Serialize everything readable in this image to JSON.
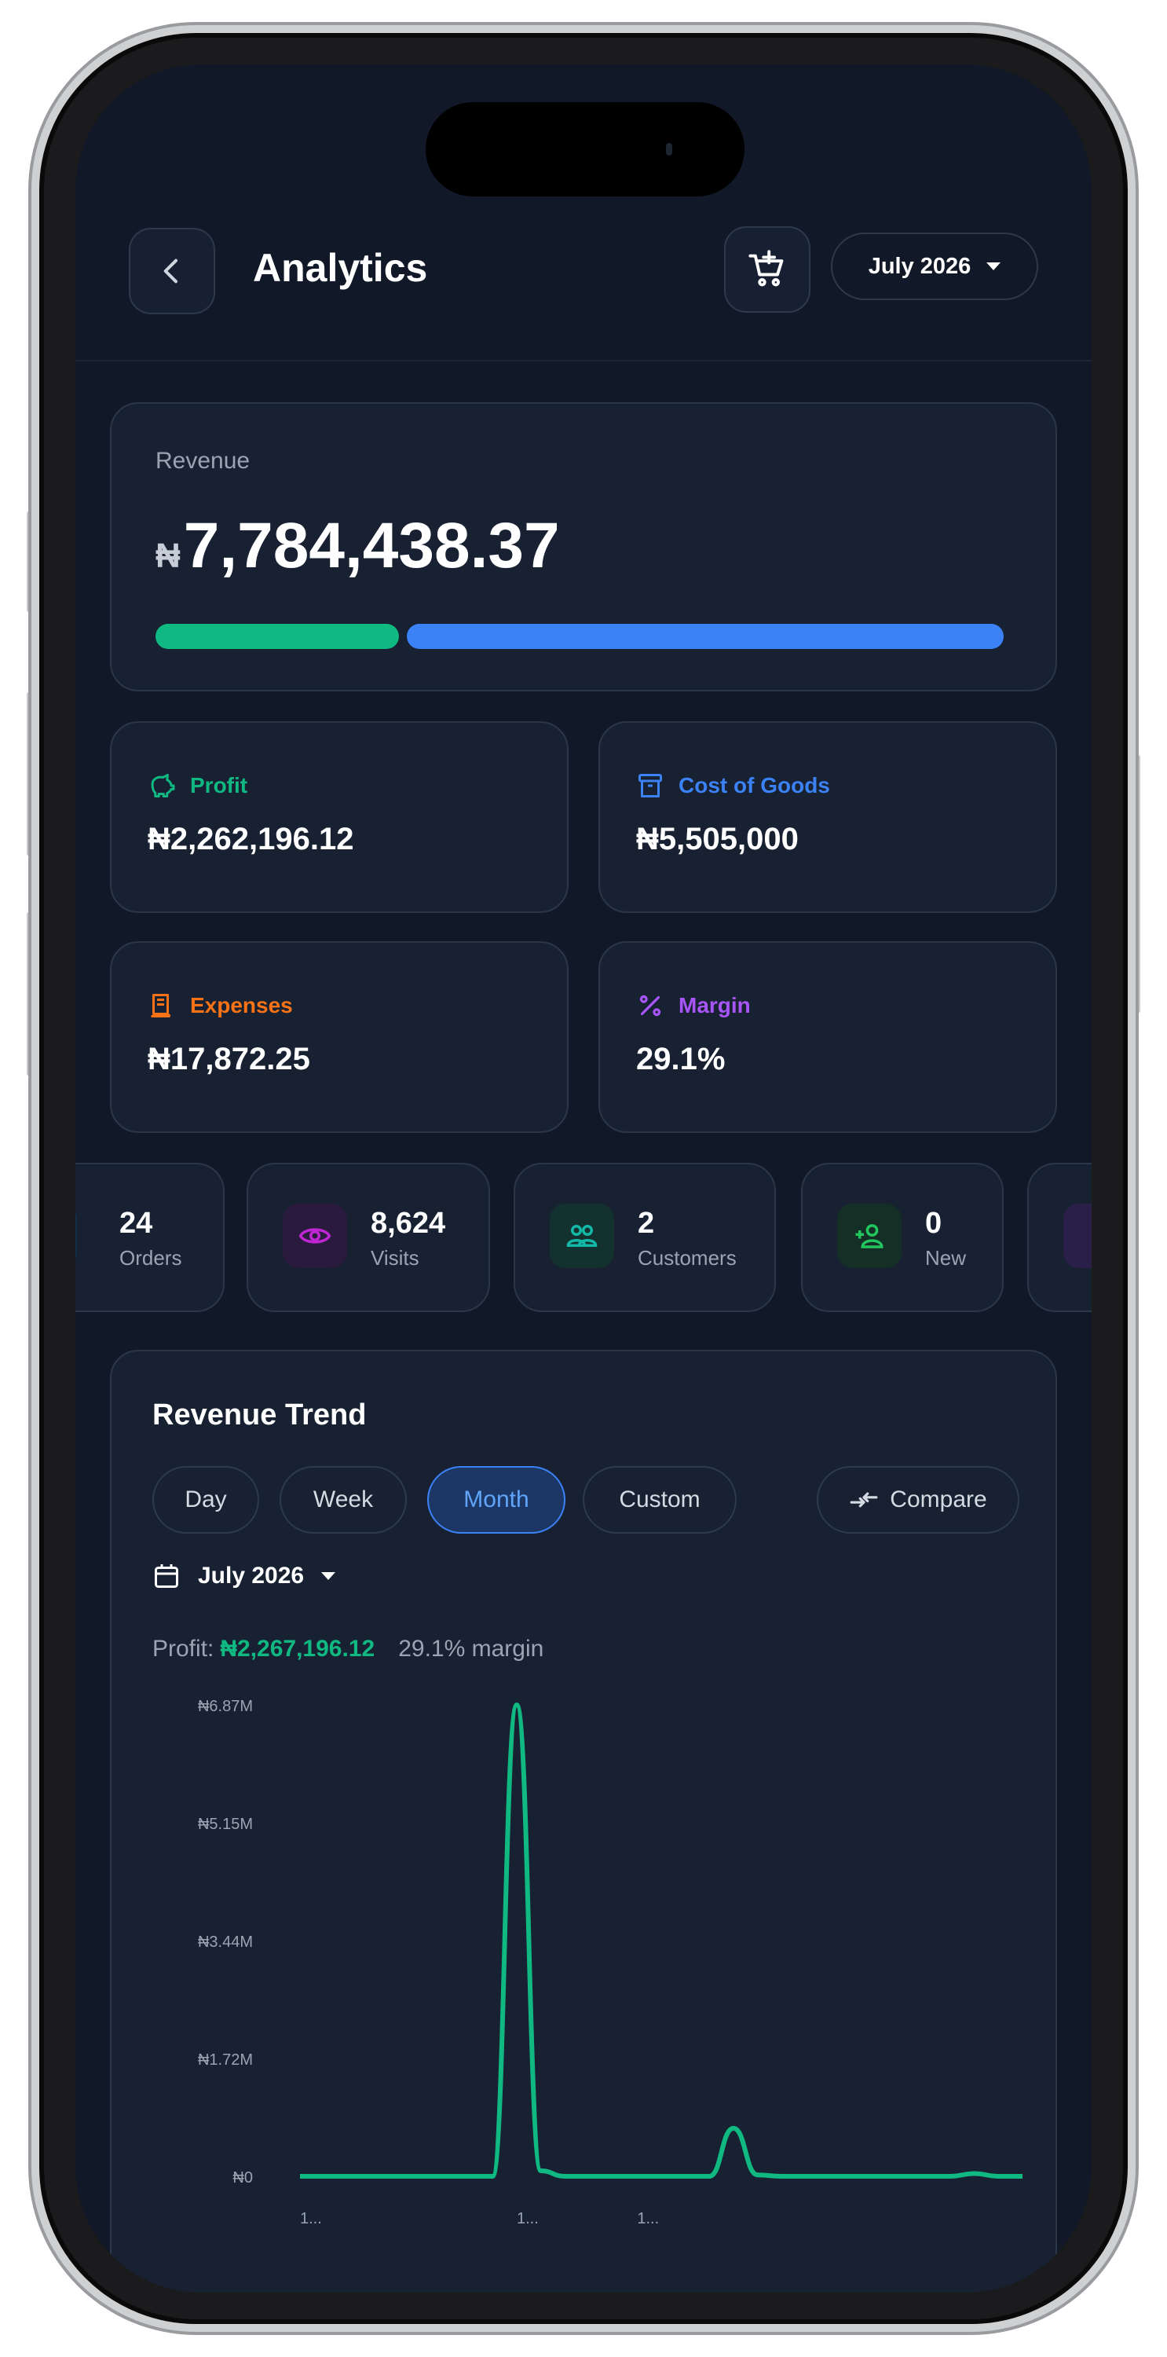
{
  "header": {
    "title": "Analytics",
    "period_label": "July 2026"
  },
  "revenue": {
    "label": "Revenue",
    "currency": "₦",
    "amount": "7,784,438.37",
    "bar_split": {
      "profit_fraction": 0.29,
      "cost_fraction": 0.71
    },
    "colors": {
      "profit": "#10b981",
      "cost": "#3b82f6"
    }
  },
  "stats": [
    {
      "label": "Profit",
      "value": "₦2,262,196.12",
      "color": "#10b981",
      "icon": "piggy-bank-icon"
    },
    {
      "label": "Cost of Goods",
      "value": "₦5,505,000",
      "color": "#3b82f6",
      "icon": "archive-box-icon"
    },
    {
      "label": "Expenses",
      "value": "₦17,872.25",
      "color": "#f97316",
      "icon": "receipt-icon"
    },
    {
      "label": "Margin",
      "value": "29.1%",
      "color": "#a855f7",
      "icon": "percent-icon"
    }
  ],
  "mini_stats": [
    {
      "value": "24",
      "label": "Orders",
      "icon": "orders-icon"
    },
    {
      "value": "8,624",
      "label": "Visits",
      "icon": "eye-icon"
    },
    {
      "value": "2",
      "label": "Customers",
      "icon": "users-icon"
    },
    {
      "value": "0",
      "label": "New",
      "icon": "user-plus-icon"
    }
  ],
  "trend": {
    "title": "Revenue Trend",
    "tabs": [
      "Day",
      "Week",
      "Month",
      "Custom"
    ],
    "active_tab": "Month",
    "compare_label": "Compare",
    "date_label": "July 2026",
    "profit_label": "Profit:",
    "profit_value": "₦2,267,196.12",
    "margin_label": "29.1% margin"
  },
  "chart_data": {
    "type": "line",
    "title": "",
    "xlabel": "",
    "ylabel": "",
    "y_ticks": [
      "₦0",
      "₦1.72M",
      "₦3.44M",
      "₦5.15M",
      "₦6.87M"
    ],
    "ylim": [
      0,
      6870000
    ],
    "x_tick_labels": [
      "1...",
      "1...",
      "1..."
    ],
    "x": [
      1,
      2,
      3,
      4,
      5,
      6,
      7,
      8,
      9,
      10,
      11,
      12,
      13,
      14,
      15,
      16,
      17,
      18,
      19,
      20,
      21,
      22,
      23,
      24,
      25,
      26,
      27,
      28,
      29,
      30,
      31
    ],
    "series": [
      {
        "values": [
          0,
          0,
          0,
          0,
          0,
          0,
          0,
          0,
          0,
          6870000,
          80000,
          0,
          0,
          0,
          0,
          0,
          0,
          0,
          700000,
          20000,
          0,
          0,
          0,
          0,
          0,
          0,
          0,
          0,
          40000,
          0,
          0
        ],
        "color": "#10b981"
      }
    ],
    "grid": false
  }
}
